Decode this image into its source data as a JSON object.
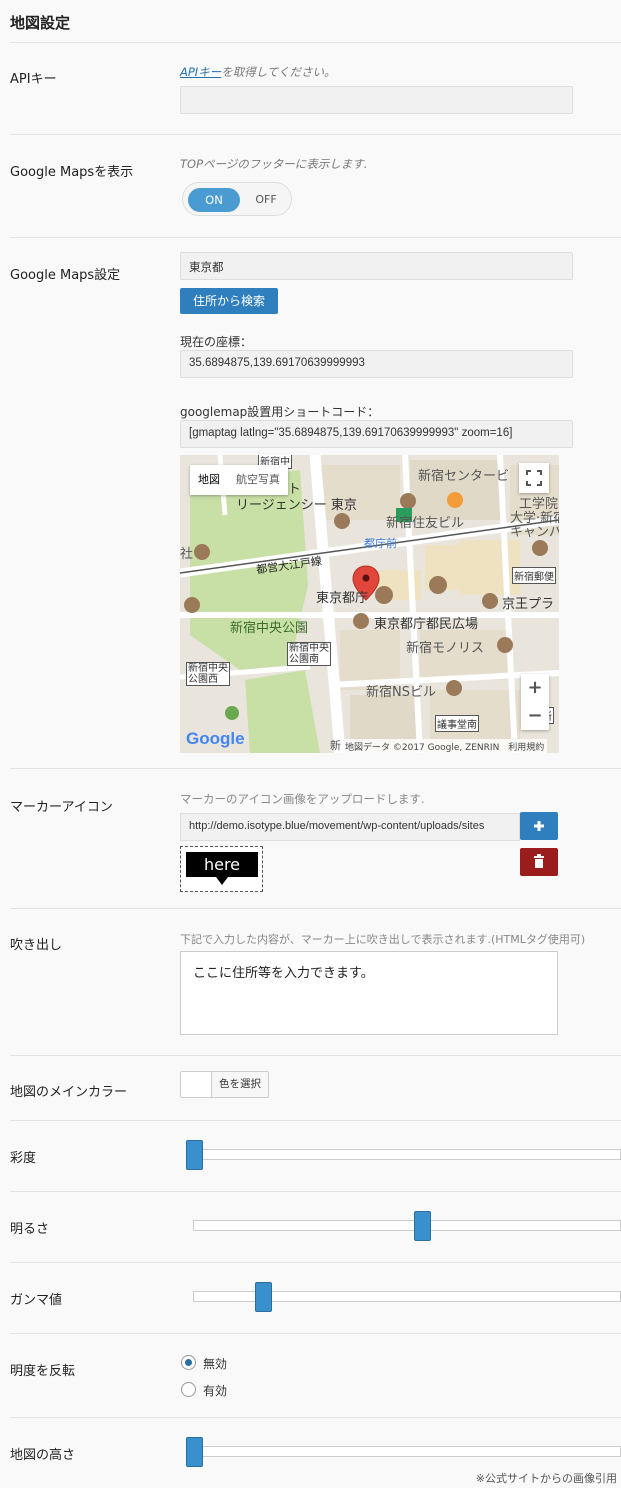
{
  "section_title": "地図設定",
  "api": {
    "label": "APIキー",
    "link": "APIキー",
    "desc_suffix": "を取得してください。",
    "value": ""
  },
  "show_maps": {
    "label": "Google Mapsを表示",
    "desc": "TOPページのフッターに表示します.",
    "on": "ON",
    "off": "OFF"
  },
  "maps_settings": {
    "label": "Google Maps設定",
    "address": "東京都",
    "search_button": "住所から検索",
    "coords_label": "現在の座標：",
    "coords": "35.6894875,139.69170639999993",
    "shortcode_label": "googlemap設置用ショートコード：",
    "shortcode": "[gmaptag latlng=\"35.6894875,139.69170639999993\" zoom=16]"
  },
  "map": {
    "tab_map": "地図",
    "tab_satellite": "航空写真",
    "zoom_in": "+",
    "zoom_out": "−",
    "copyright": "地図データ ©2017 Google, ZENRIN",
    "terms": "利用規約",
    "logo": "Google",
    "labels": {
      "hyatt": "ハイアット",
      "regency": "リージェンシー 東京",
      "shinjuku_center": "新宿センタービ",
      "kogakuin1": "工学院",
      "kogakuin2": "大学·新宿",
      "kogakuin3": "キャンパ",
      "sumitomo": "新宿住友ビル",
      "tochomae": "都庁前",
      "oedo": "都営大江戸線",
      "post": "新宿郵便",
      "tocho": "東京都庁",
      "keio": "京王プラ",
      "plaza": "東京都庁都民広場",
      "park": "新宿中央公園",
      "park_south": "新宿中央\n公園南",
      "park_west": "新宿中央\n公園西",
      "monolith": "新宿モノリス",
      "ns": "新宿NSビル",
      "gijido": "議事堂南",
      "nishi": "西新",
      "top_station": "新宿中",
      "shrine": "社",
      "shin": "新"
    },
    "colors": {
      "park": "#c8dfa6",
      "road": "#ffffff",
      "building": "#e4ddcc",
      "marker": "#e2463b"
    }
  },
  "marker_icon": {
    "label": "マーカーアイコン",
    "desc": "マーカーのアイコン画像をアップロードします.",
    "url": "http://demo.isotype.blue/movement/wp-content/uploads/sites",
    "preview_text": "here",
    "add_icon": "plus-icon",
    "delete_icon": "trash-icon"
  },
  "balloon": {
    "label": "吹き出し",
    "desc": "下記で入力した内容が、マーカー上に吹き出しで表示されます.(HTMLタグ使用可)",
    "text": "ここに住所等を入力できます。"
  },
  "main_color": {
    "label": "地図のメインカラー",
    "button": "色を選択"
  },
  "saturation": {
    "label": "彩度",
    "level": 0.0
  },
  "brightness": {
    "label": "明るさ",
    "level": 0.54
  },
  "gamma": {
    "label": "ガンマ値",
    "level": 0.15
  },
  "invert": {
    "label": "明度を反転",
    "options": [
      "無効",
      "有効"
    ],
    "selected": "無効"
  },
  "height": {
    "label": "地図の高さ",
    "level": 0.0
  },
  "footnote": "※公式サイトからの画像引用"
}
